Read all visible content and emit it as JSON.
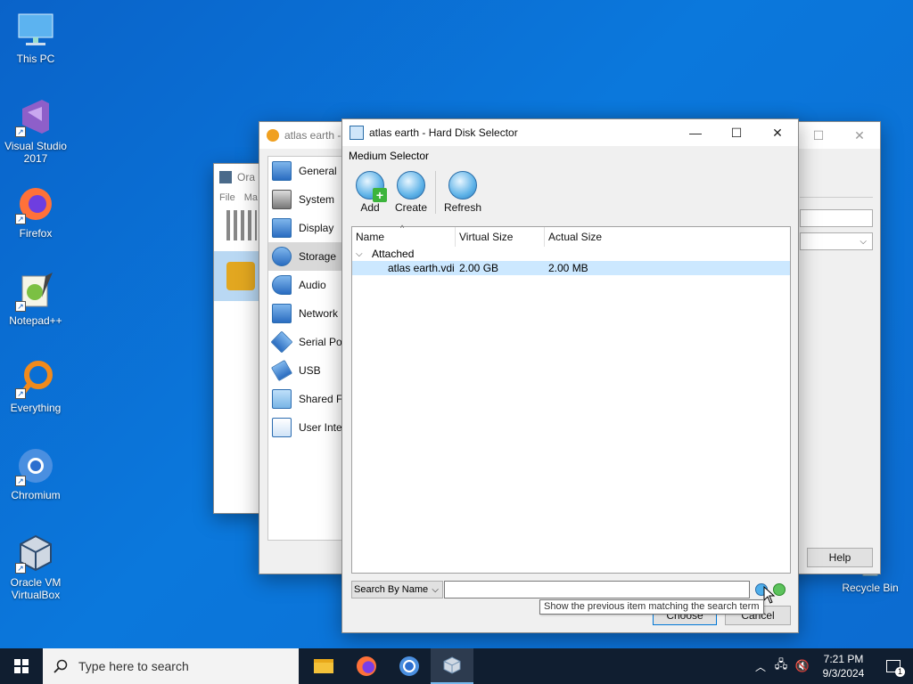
{
  "desktop": {
    "icons": [
      {
        "label": "This PC"
      },
      {
        "label": "Visual Studio\n2017"
      },
      {
        "label": "Firefox"
      },
      {
        "label": "Notepad++"
      },
      {
        "label": "Everything"
      },
      {
        "label": "Chromium"
      },
      {
        "label": "Oracle VM\nVirtualBox"
      }
    ],
    "recycle_bin": "Recycle Bin"
  },
  "vbox_manager": {
    "title": "Ora",
    "menu": [
      "File",
      "Ma"
    ]
  },
  "settings_window": {
    "title": "atlas earth -",
    "categories": [
      "General",
      "System",
      "Display",
      "Storage",
      "Audio",
      "Network",
      "Serial Port",
      "USB",
      "Shared Fo",
      "User Inter"
    ],
    "selected": "Storage",
    "help_button": "Help"
  },
  "dialog": {
    "title": "atlas earth - Hard Disk Selector",
    "section_label": "Medium Selector",
    "toolbar": {
      "add": "Add",
      "create": "Create",
      "refresh": "Refresh"
    },
    "columns": {
      "name": "Name",
      "virtual_size": "Virtual Size",
      "actual_size": "Actual Size"
    },
    "group": "Attached",
    "rows": [
      {
        "name": "atlas earth.vdi",
        "virtual_size": "2.00 GB",
        "actual_size": "2.00 MB"
      }
    ],
    "search_mode": "Search By Name",
    "search_value": "",
    "tooltip": "Show the previous item matching the search term",
    "choose_button": "Choose",
    "cancel_button": "Cancel"
  },
  "taskbar": {
    "search_placeholder": "Type here to search",
    "time": "7:21 PM",
    "date": "9/3/2024",
    "notification_count": "1"
  },
  "colors": {
    "accent": "#0078d7",
    "selection": "#cce8ff",
    "taskbar": "#101e30"
  }
}
